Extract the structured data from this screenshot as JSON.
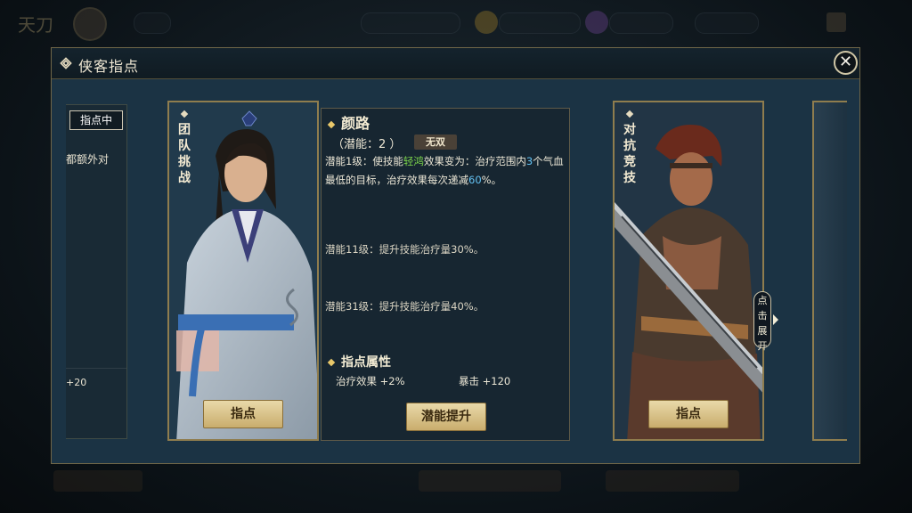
{
  "modal": {
    "title": "侠客指点",
    "close_label": "✕"
  },
  "left_card": {
    "status": "指点中",
    "text": "都额外对",
    "value": "+20"
  },
  "card_team": {
    "mode": [
      "团",
      "队",
      "挑",
      "战"
    ],
    "button": "指点"
  },
  "skill": {
    "name": "颜路",
    "potential": "（潜能：2 ）",
    "badge": "无双",
    "desc_prefix": "潜能1级：使技能",
    "desc_skill": "轻鸿",
    "desc_mid": "效果变为：治疗范围内",
    "desc_num1": "3",
    "desc_mid2": "个气血最低的目标，治疗效果每次递减",
    "desc_num2": "60",
    "desc_end": "%。",
    "lv11": "潜能11级：提升技能治疗量30%。",
    "lv31": "潜能31级：提升技能治疗量40%。",
    "attr_head": "指点属性",
    "attr1": "治疗效果 +2%",
    "attr2": "暴击 +120",
    "button": "潜能提升"
  },
  "card_pvp": {
    "mode": [
      "对",
      "抗",
      "竞",
      "技"
    ],
    "button": "指点"
  },
  "expand": [
    "点",
    "击",
    "展",
    "开"
  ],
  "colors": {
    "gold": "#c9ad6d",
    "panel": "#1b3344",
    "green_skill": "#7dd64c",
    "blue_number": "#63c1f2"
  }
}
